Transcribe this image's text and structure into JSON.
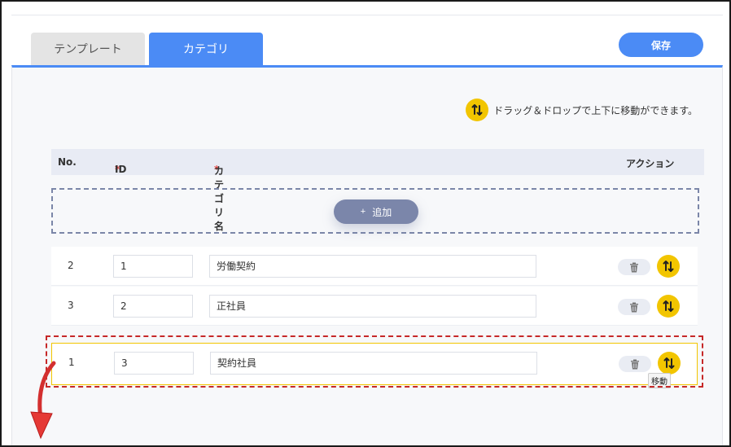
{
  "tabs": [
    {
      "label": "テンプレート",
      "active": false
    },
    {
      "label": "カテゴリ",
      "active": true
    }
  ],
  "toolbar": {
    "save_label": "保存"
  },
  "hint": {
    "text": "ドラッグ＆ドロップで上下に移動ができます。",
    "icon": "drag-sort-icon"
  },
  "table": {
    "headers": {
      "no": "No.",
      "id_required": "*",
      "id": "ID",
      "name_required": "*",
      "name": "カテゴリ名",
      "action": "アクション"
    },
    "add_label": "追加",
    "rows": [
      {
        "no": "2",
        "id": "1",
        "name": "労働契約"
      },
      {
        "no": "3",
        "id": "2",
        "name": "正社員"
      },
      {
        "no": "1",
        "id": "3",
        "name": "契約社員"
      }
    ]
  },
  "tooltip": {
    "move": "移動"
  },
  "colors": {
    "accent": "#4b8bf5",
    "drag": "#f2c500",
    "highlight": "#c62828",
    "add_button": "#7b86aa"
  }
}
